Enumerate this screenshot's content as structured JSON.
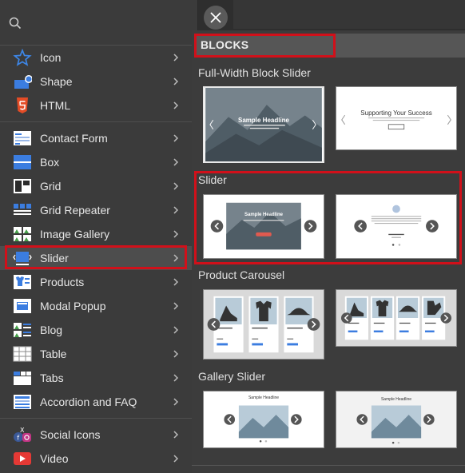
{
  "search": {
    "placeholder": "",
    "value": ""
  },
  "menu": {
    "items": [
      {
        "label": "Icon",
        "icon": "star-icon"
      },
      {
        "label": "Shape",
        "icon": "shape-icon"
      },
      {
        "label": "HTML",
        "icon": "html5-icon"
      },
      {
        "label": "Contact Form",
        "icon": "contact-form-icon"
      },
      {
        "label": "Box",
        "icon": "box-icon"
      },
      {
        "label": "Grid",
        "icon": "grid-icon"
      },
      {
        "label": "Grid Repeater",
        "icon": "grid-repeater-icon"
      },
      {
        "label": "Image Gallery",
        "icon": "image-gallery-icon"
      },
      {
        "label": "Slider",
        "icon": "slider-icon"
      },
      {
        "label": "Products",
        "icon": "products-icon"
      },
      {
        "label": "Modal Popup",
        "icon": "modal-popup-icon"
      },
      {
        "label": "Blog",
        "icon": "blog-icon"
      },
      {
        "label": "Table",
        "icon": "table-icon"
      },
      {
        "label": "Tabs",
        "icon": "tabs-icon"
      },
      {
        "label": "Accordion and FAQ",
        "icon": "accordion-icon"
      },
      {
        "label": "Social Icons",
        "icon": "social-icons-icon"
      },
      {
        "label": "Video",
        "icon": "video-icon"
      }
    ],
    "active": "Slider"
  },
  "panel": {
    "header": "BLOCKS",
    "sections": [
      {
        "title": "Full-Width Block Slider",
        "thumbs": [
          {
            "text": "Sample Headline"
          },
          {
            "text": "Supporting Your Success"
          }
        ]
      },
      {
        "title": "Slider",
        "thumbs": [
          {
            "text": "Sample Headline"
          },
          {
            "text": ""
          }
        ]
      },
      {
        "title": "Product Carousel",
        "thumbs": [
          {
            "text": ""
          },
          {
            "text": ""
          }
        ]
      },
      {
        "title": "Gallery Slider",
        "thumbs": [
          {
            "text": "Sample Headline"
          },
          {
            "text": "Sample Headline"
          }
        ]
      }
    ]
  },
  "colors": {
    "highlight": "#d1101a",
    "accent_blue": "#3b7de0",
    "panel_bg": "#3c3c3c"
  }
}
